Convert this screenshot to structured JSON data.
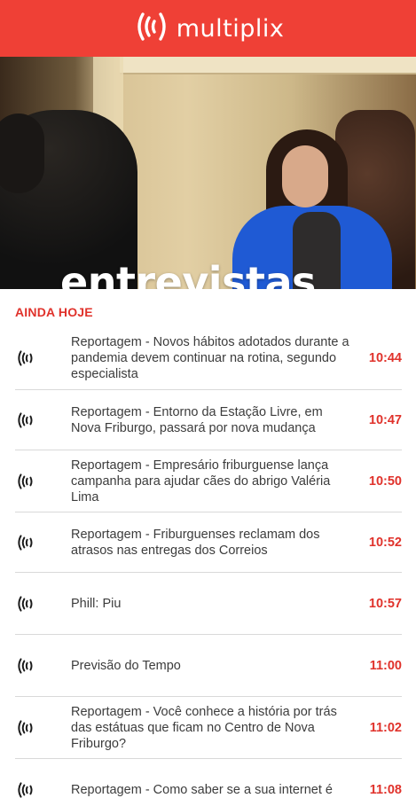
{
  "header": {
    "brand": "multiplix",
    "icon": "sound-wave-logo-icon"
  },
  "hero": {
    "title": "entrevistas"
  },
  "schedule": {
    "section_title": "AINDA HOJE",
    "accent_color": "#e0322b",
    "items": [
      {
        "title": "Reportagem - Novos hábitos adotados durante a pandemia devem continuar na rotina, segundo especialista",
        "time": "10:44"
      },
      {
        "title": "Reportagem - Entorno da Estação Livre, em Nova Friburgo, passará por nova mudança",
        "time": "10:47"
      },
      {
        "title": "Reportagem - Empresário friburguense lança campanha para ajudar cães do abrigo Valéria Lima",
        "time": "10:50"
      },
      {
        "title": "Reportagem - Friburguenses reclamam dos atrasos nas entregas dos Correios",
        "time": "10:52"
      },
      {
        "title": "Phill: Piu",
        "time": "10:57"
      },
      {
        "title": "Previsão do Tempo",
        "time": "11:00"
      },
      {
        "title": "Reportagem - Você conhece a história por trás das estátuas que ficam no Centro de Nova Friburgo?",
        "time": "11:02"
      },
      {
        "title": "Reportagem - Como saber se a sua internet é",
        "time": "11:08"
      }
    ]
  }
}
